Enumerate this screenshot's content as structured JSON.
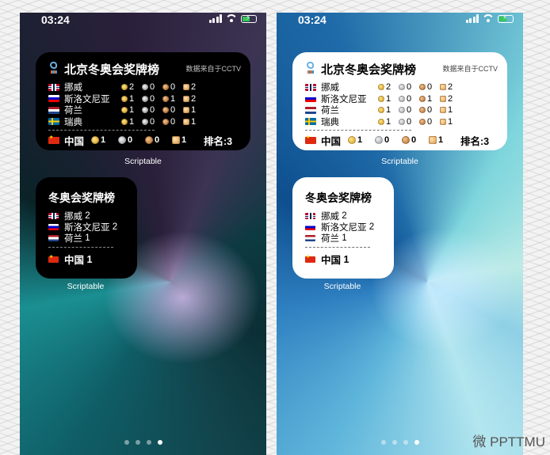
{
  "status": {
    "time": "03:24"
  },
  "widget_large": {
    "title": "北京冬奥会奖牌榜",
    "source": "数据来自于CCTV",
    "rows": [
      {
        "country": "挪威",
        "flag": "NO",
        "gold": "2",
        "silver": "0",
        "bronze": "0",
        "total": "2"
      },
      {
        "country": "斯洛文尼亚",
        "flag": "SI",
        "gold": "1",
        "silver": "0",
        "bronze": "1",
        "total": "2"
      },
      {
        "country": "荷兰",
        "flag": "NL",
        "gold": "1",
        "silver": "0",
        "bronze": "0",
        "total": "1"
      },
      {
        "country": "瑞典",
        "flag": "SE",
        "gold": "1",
        "silver": "0",
        "bronze": "0",
        "total": "1"
      }
    ],
    "china": {
      "country": "中国",
      "gold": "1",
      "silver": "0",
      "bronze": "0",
      "total": "1",
      "rank": "排名:3"
    },
    "label": "Scriptable"
  },
  "widget_small": {
    "title": "冬奥会奖牌榜",
    "rows": [
      {
        "country": "挪威",
        "total": "2"
      },
      {
        "country": "斯洛文尼亚",
        "total": "2"
      },
      {
        "country": "荷兰",
        "total": "1"
      }
    ],
    "china": {
      "country": "中国",
      "total": "1"
    },
    "label": "Scriptable"
  },
  "watermark": "微 PPTTMU",
  "colors": {
    "battery_green": "#34c759",
    "dark_widget": "#000000",
    "light_widget": "#ffffff"
  },
  "icons": [
    "signal-icon",
    "wifi-icon",
    "battery-charging-icon",
    "beijing-2022-logo-icon",
    "gold-medal-icon",
    "silver-medal-icon",
    "bronze-medal-icon",
    "total-medal-icon"
  ]
}
